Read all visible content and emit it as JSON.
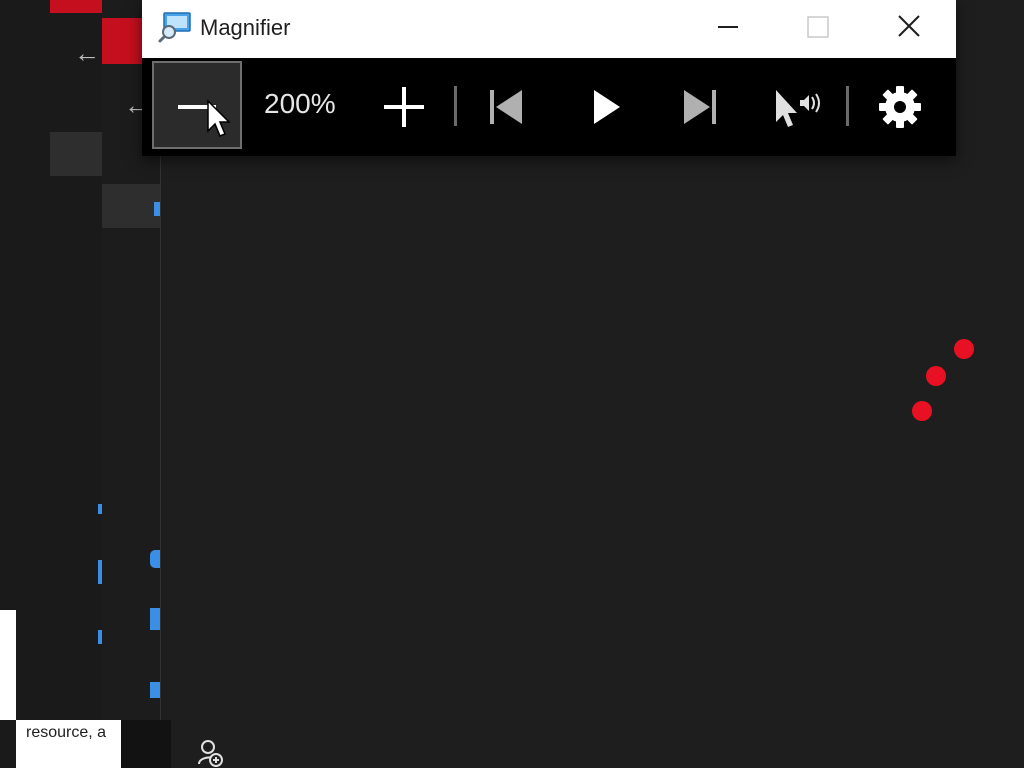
{
  "magnifier": {
    "title": "Magnifier",
    "zoom_level": "200%",
    "controls": {
      "zoom_out": "zoom-out",
      "zoom_in": "zoom-in",
      "previous": "previous",
      "play": "play",
      "next": "next",
      "read_from_pointer": "read-from-pointer",
      "settings": "settings"
    }
  },
  "background": {
    "tooltip_text": "resource, a"
  },
  "colors": {
    "accent_red": "#e81123",
    "toolbar_bg": "#000000",
    "title_bg": "#ffffff",
    "workspace_bg": "#1e1e1e"
  }
}
